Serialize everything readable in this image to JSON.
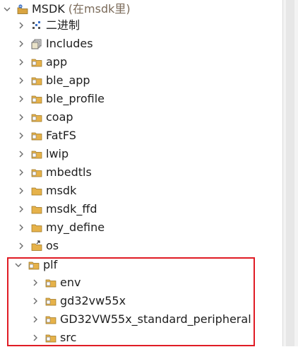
{
  "root": {
    "label": "MSDK",
    "annotation": "(在msdk里)"
  },
  "items": [
    {
      "label": "二进制",
      "icon": "binaries-icon"
    },
    {
      "label": "Includes",
      "icon": "includes-icon"
    },
    {
      "label": "app",
      "icon": "folder-icon"
    },
    {
      "label": "ble_app",
      "icon": "folder-icon"
    },
    {
      "label": "ble_profile",
      "icon": "folder-icon"
    },
    {
      "label": "coap",
      "icon": "folder-icon"
    },
    {
      "label": "FatFS",
      "icon": "folder-icon"
    },
    {
      "label": "lwip",
      "icon": "folder-icon"
    },
    {
      "label": "mbedtls",
      "icon": "folder-icon"
    },
    {
      "label": "msdk",
      "icon": "folder-icon"
    },
    {
      "label": "msdk_ffd",
      "icon": "folder-icon"
    },
    {
      "label": "my_define",
      "icon": "folder-icon"
    },
    {
      "label": "os",
      "icon": "folder-icon"
    },
    {
      "label": "plf",
      "icon": "folder-icon",
      "expanded": true
    }
  ],
  "plf_children": [
    {
      "label": "env"
    },
    {
      "label": "gd32vw55x"
    },
    {
      "label": "GD32VW55x_standard_peripheral"
    },
    {
      "label": "src"
    }
  ],
  "colors": {
    "highlight_border": "#e01b24",
    "folder": "#d9a441",
    "chevron": "#6b6b6b"
  }
}
